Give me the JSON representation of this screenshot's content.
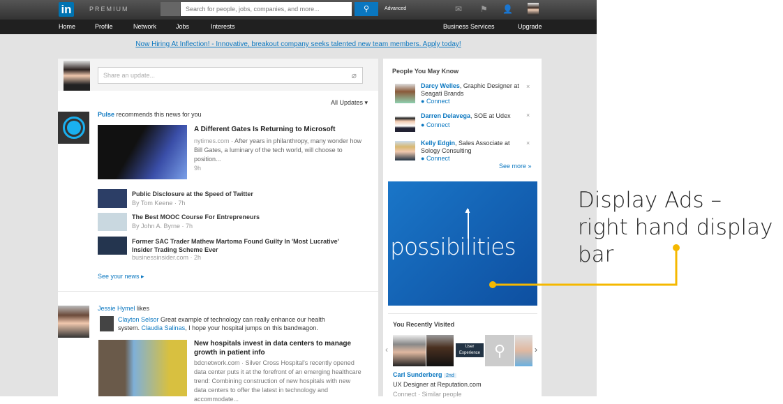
{
  "header": {
    "logo": "in",
    "premium": "PREMIUM",
    "search_placeholder": "Search for people, jobs, companies, and more...",
    "advanced": "Advanced"
  },
  "nav": {
    "items": [
      "Home",
      "Profile",
      "Network",
      "Jobs",
      "Interests"
    ],
    "business": "Business Services",
    "upgrade": "Upgrade"
  },
  "promo": "Now Hiring At Inflection! - Innovative, breakout company seeks talented new team members. Apply today!",
  "feed": {
    "share_placeholder": "Share an update...",
    "filter": "All Updates ▾",
    "pulse": {
      "source": "Pulse",
      "text": "recommends this news for you",
      "main": {
        "title": "A Different Gates Is Returning to Microsoft",
        "site": "nytimes.com",
        "summary": "After years in philanthropy, many wonder how Bill Gates, a luminary of the tech world, will choose to position...",
        "time": "9h"
      },
      "items": [
        {
          "title": "Public Disclosure at the Speed of Twitter",
          "meta": "By Tom Keene · 7h"
        },
        {
          "title": "The Best MOOC Course For Entrepreneurs",
          "meta": "By John A. Byrne · 7h"
        },
        {
          "title": "Former SAC Trader Mathew Martoma Found Guilty In 'Most Lucrative' Insider Trading Scheme Ever",
          "meta": "businessinsider.com · 2h"
        }
      ],
      "see_news": "See your news ▸"
    },
    "like": {
      "user": "Jessie Hymel",
      "action": "likes",
      "commenter": "Clayton Selsor",
      "comment": "Great example of technology can really enhance our health system.",
      "mention": "Claudia Salinas",
      "comment2": ", I hope your hospital jumps on this bandwagon.",
      "title": "New hospitals invest in data centers to manage growth in patient info",
      "site": "bdcnetwork.com",
      "summary": "Silver Cross Hospital's recently opened data center puts it at the forefront of an emerging healthcare trend: Combining construction of new hospitals with new data centers to offer the latest in technology and accommodate..."
    }
  },
  "pymk": {
    "title": "People You May Know",
    "people": [
      {
        "name": "Darcy Welles",
        "role": ", Graphic Designer at Seagati Brands",
        "connect": "Connect"
      },
      {
        "name": "Darren Delavega",
        "role": ", SOE at Udex",
        "connect": "Connect"
      },
      {
        "name": "Kelly Edgin",
        "role": ", Sales Associate at Sology Consulting",
        "connect": "Connect"
      }
    ],
    "see_more": "See more »"
  },
  "ad": {
    "text": "possibilities"
  },
  "visited": {
    "title": "You Recently Visited",
    "tile": "User Experience",
    "name": "Carl Sunderberg",
    "degree": "2nd",
    "role": "UX Designer at Reputation.com",
    "actions": "Connect · Similar people"
  },
  "annotation": "Display Ads – right hand display bar",
  "colors": {
    "accent": "#0a77c0",
    "annotation": "#f5b800"
  }
}
